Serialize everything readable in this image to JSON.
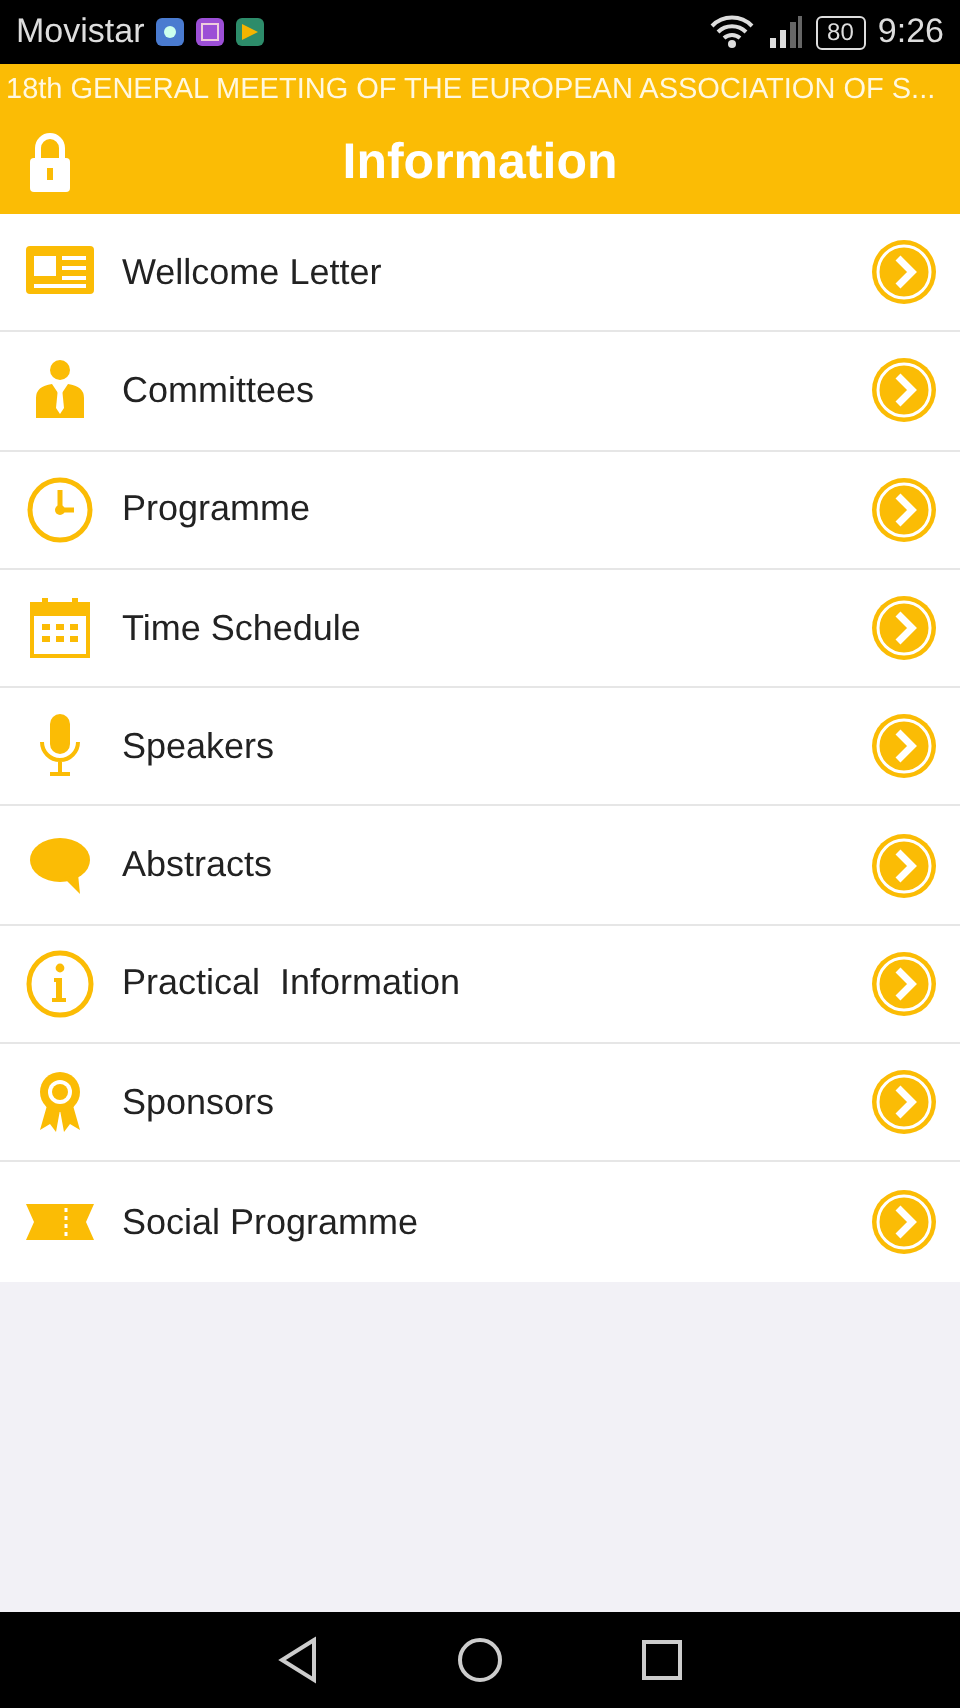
{
  "status_bar": {
    "carrier": "Movistar",
    "battery": "80",
    "time": "9:26"
  },
  "subtitle": "18th GENERAL MEETING OF THE EUROPEAN ASSOCIATION OF S...",
  "header": {
    "title": "Information"
  },
  "items": [
    {
      "label": "Wellcome Letter"
    },
    {
      "label": "Committees"
    },
    {
      "label": "Programme"
    },
    {
      "label": "Time Schedule"
    },
    {
      "label": "Speakers"
    },
    {
      "label": "Abstracts"
    },
    {
      "label": "Practical  Information"
    },
    {
      "label": "Sponsors"
    },
    {
      "label": "Social Programme"
    }
  ]
}
